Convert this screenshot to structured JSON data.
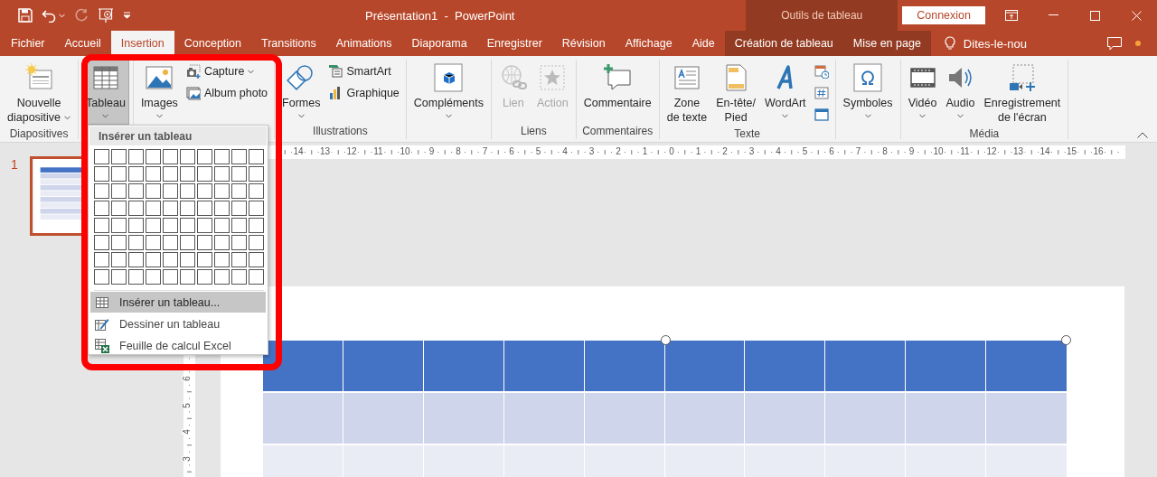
{
  "title_bar": {
    "quick_access": [
      {
        "kind": "save",
        "disabled": false
      },
      {
        "kind": "undo",
        "disabled": false
      },
      {
        "kind": "redo",
        "disabled": true
      },
      {
        "kind": "present",
        "disabled": false
      },
      {
        "kind": "customize",
        "disabled": false
      }
    ],
    "title": "Présentation1  -  PowerPoint",
    "context_label": "Outils de tableau",
    "sign_in": "Connexion"
  },
  "tabs": [
    {
      "label": "Fichier",
      "selected": false,
      "kind": "normal"
    },
    {
      "label": "Accueil",
      "selected": false,
      "kind": "normal"
    },
    {
      "label": "Insertion",
      "selected": true,
      "kind": "normal"
    },
    {
      "label": "Conception",
      "selected": false,
      "kind": "normal"
    },
    {
      "label": "Transitions",
      "selected": false,
      "kind": "normal"
    },
    {
      "label": "Animations",
      "selected": false,
      "kind": "normal"
    },
    {
      "label": "Diaporama",
      "selected": false,
      "kind": "normal"
    },
    {
      "label": "Enregistrer",
      "selected": false,
      "kind": "normal"
    },
    {
      "label": "Révision",
      "selected": false,
      "kind": "normal"
    },
    {
      "label": "Affichage",
      "selected": false,
      "kind": "normal"
    },
    {
      "label": "Aide",
      "selected": false,
      "kind": "normal"
    },
    {
      "label": "Création de tableau",
      "selected": false,
      "kind": "contextual"
    },
    {
      "label": "Mise en page",
      "selected": false,
      "kind": "contextual"
    }
  ],
  "tell_me": "Dites-le-nou",
  "ribbon": {
    "groups": [
      {
        "label": "Diapositives",
        "controls": [
          {
            "kind": "large",
            "lines": [
              "Nouvelle",
              "diapositive"
            ],
            "dropdown": true,
            "pressed": false,
            "disabled": false
          }
        ]
      },
      {
        "controls": [
          {
            "kind": "large",
            "lines": [
              "Tableau"
            ],
            "dropdown": true,
            "pressed": true,
            "disabled": false
          }
        ]
      },
      {
        "controls": [
          {
            "kind": "large",
            "lines": [
              "Images"
            ],
            "dropdown": true,
            "pressed": false,
            "disabled": false
          },
          {
            "kind": "stack",
            "items": [
              {
                "label": "Capture",
                "dropdown": true,
                "disabled": false
              },
              {
                "label": "Album photo",
                "dropdown": false,
                "disabled": false
              }
            ]
          }
        ]
      },
      {
        "label": "Illustrations",
        "controls": [
          {
            "kind": "large",
            "lines": [
              "Formes"
            ],
            "dropdown": true,
            "pressed": false,
            "disabled": false
          },
          {
            "kind": "stack",
            "items": [
              {
                "label": "SmartArt",
                "dropdown": false,
                "disabled": false
              },
              {
                "label": "Graphique",
                "dropdown": false,
                "disabled": false
              }
            ]
          }
        ]
      },
      {
        "controls": [
          {
            "kind": "large",
            "lines": [
              "Compléments"
            ],
            "dropdown": true,
            "pressed": false,
            "disabled": false
          }
        ]
      },
      {
        "label": "Liens",
        "controls": [
          {
            "kind": "large",
            "lines": [
              "Lien"
            ],
            "dropdown": false,
            "pressed": false,
            "disabled": true
          },
          {
            "kind": "large",
            "lines": [
              "Action"
            ],
            "dropdown": false,
            "pressed": false,
            "disabled": true
          }
        ]
      },
      {
        "label": "Commentaires",
        "controls": [
          {
            "kind": "large",
            "lines": [
              "Commentaire"
            ],
            "dropdown": false,
            "pressed": false,
            "disabled": false
          }
        ]
      },
      {
        "label": "Texte",
        "controls": [
          {
            "kind": "large",
            "lines": [
              "Zone",
              "de texte"
            ],
            "dropdown": false,
            "pressed": false,
            "disabled": false
          },
          {
            "kind": "large",
            "lines": [
              "En-tête/",
              "Pied"
            ],
            "dropdown": false,
            "pressed": false,
            "disabled": false
          },
          {
            "kind": "large",
            "lines": [
              "WordArt"
            ],
            "dropdown": true,
            "pressed": false,
            "disabled": false
          },
          {
            "kind": "stack",
            "items": [
              {
                "disabled": false
              },
              {
                "disabled": false
              },
              {
                "disabled": false
              }
            ]
          }
        ]
      },
      {
        "controls": [
          {
            "kind": "large",
            "lines": [
              "Symboles"
            ],
            "dropdown": true,
            "pressed": false,
            "disabled": false
          }
        ]
      },
      {
        "label": "Média",
        "controls": [
          {
            "kind": "large",
            "lines": [
              "Vidéo"
            ],
            "dropdown": true,
            "pressed": false,
            "disabled": false
          },
          {
            "kind": "large",
            "lines": [
              "Audio"
            ],
            "dropdown": true,
            "pressed": false,
            "disabled": false
          },
          {
            "kind": "large",
            "lines": [
              "Enregistrement",
              "de l'écran"
            ],
            "dropdown": false,
            "pressed": false,
            "disabled": false
          }
        ]
      }
    ]
  },
  "slides": [
    {
      "number": "1",
      "selected": true
    }
  ],
  "horizontal_ruler": [
    "14",
    "13",
    "12",
    "11",
    "10",
    "9",
    "8",
    "7",
    "6",
    "5",
    "4",
    "3",
    "2",
    "1",
    "0",
    "1",
    "2",
    "3",
    "4",
    "5",
    "6",
    "7",
    "8",
    "9",
    "10",
    "11",
    "12",
    "13",
    "14",
    "15",
    "16"
  ],
  "vertical_ruler": [
    "6",
    "5",
    "4",
    "3"
  ],
  "slide": {
    "table_selected": true,
    "table_rows": [
      {
        "kind": "header"
      },
      {
        "kind": "band1"
      },
      {
        "kind": "band2"
      }
    ]
  },
  "table_menu": {
    "title": "Insérer un tableau",
    "items": [
      {
        "label": "Insérer un tableau...",
        "selected": true
      },
      {
        "label": "Dessiner un tableau",
        "selected": false
      },
      {
        "label": "Feuille de calcul Excel",
        "selected": false
      }
    ]
  }
}
